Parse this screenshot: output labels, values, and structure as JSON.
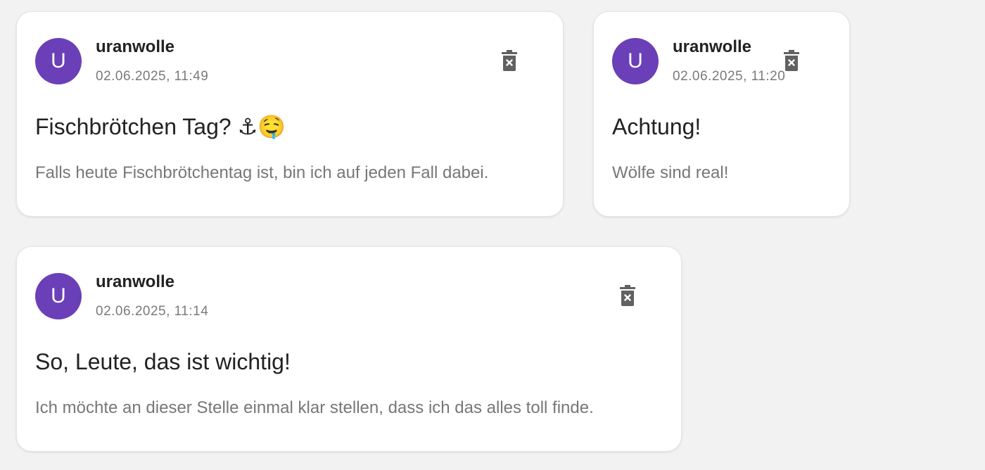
{
  "posts": [
    {
      "avatar_letter": "U",
      "username": "uranwolle",
      "timestamp": "02.06.2025, 11:49",
      "title": "Fischbrötchen Tag? ⚓🤤",
      "body": "Falls heute Fischbrötchentag ist, bin ich auf jeden Fall dabei."
    },
    {
      "avatar_letter": "U",
      "username": "uranwolle",
      "timestamp": "02.06.2025, 11:20",
      "title": "Achtung!",
      "body": "Wölfe sind real!"
    },
    {
      "avatar_letter": "U",
      "username": "uranwolle",
      "timestamp": "02.06.2025, 11:14",
      "title": "So, Leute, das ist wichtig!",
      "body": "Ich möchte an dieser Stelle einmal klar stellen, dass ich das alles toll finde."
    }
  ],
  "icons": {
    "delete": "trash-x-icon"
  },
  "colors": {
    "avatar_bg": "#6b3fb8",
    "background": "#f2f2f2",
    "card": "#ffffff",
    "title_text": "#222222",
    "muted_text": "#777777",
    "icon": "#616161"
  }
}
